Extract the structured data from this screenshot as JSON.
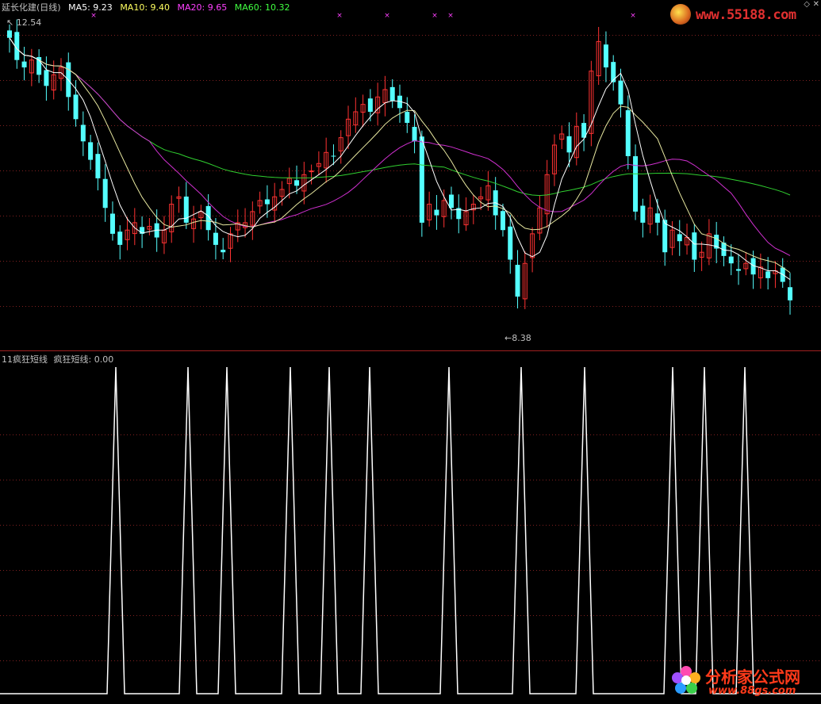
{
  "main_header": {
    "title": "延长化建(日线)",
    "ma5": "MA5: 9.23",
    "ma10": "MA10: 9.40",
    "ma20": "MA20: 9.65",
    "ma60": "MA60: 10.32"
  },
  "price_labels": {
    "high": "12.54",
    "low": "8.38"
  },
  "indicator_header": {
    "id": "11疯狂短线",
    "name": "疯狂短线: 0.00"
  },
  "watermarks": {
    "top_url": "www.55188.com",
    "bottom_name": "分析家公式网",
    "bottom_url": "www.88gs.com"
  },
  "colors": {
    "background": "#000000",
    "up": "#ff3232",
    "down": "#54ffff",
    "ma5": "#ffffff",
    "ma10": "#ffff00",
    "ma20": "#ff00ff",
    "ma60": "#00ff00",
    "grid": "#802020"
  },
  "chart_data": {
    "type": "candlestick",
    "high": 12.54,
    "low": 8.38,
    "indicator_value": 0.0,
    "indicator_spikes": 13
  }
}
